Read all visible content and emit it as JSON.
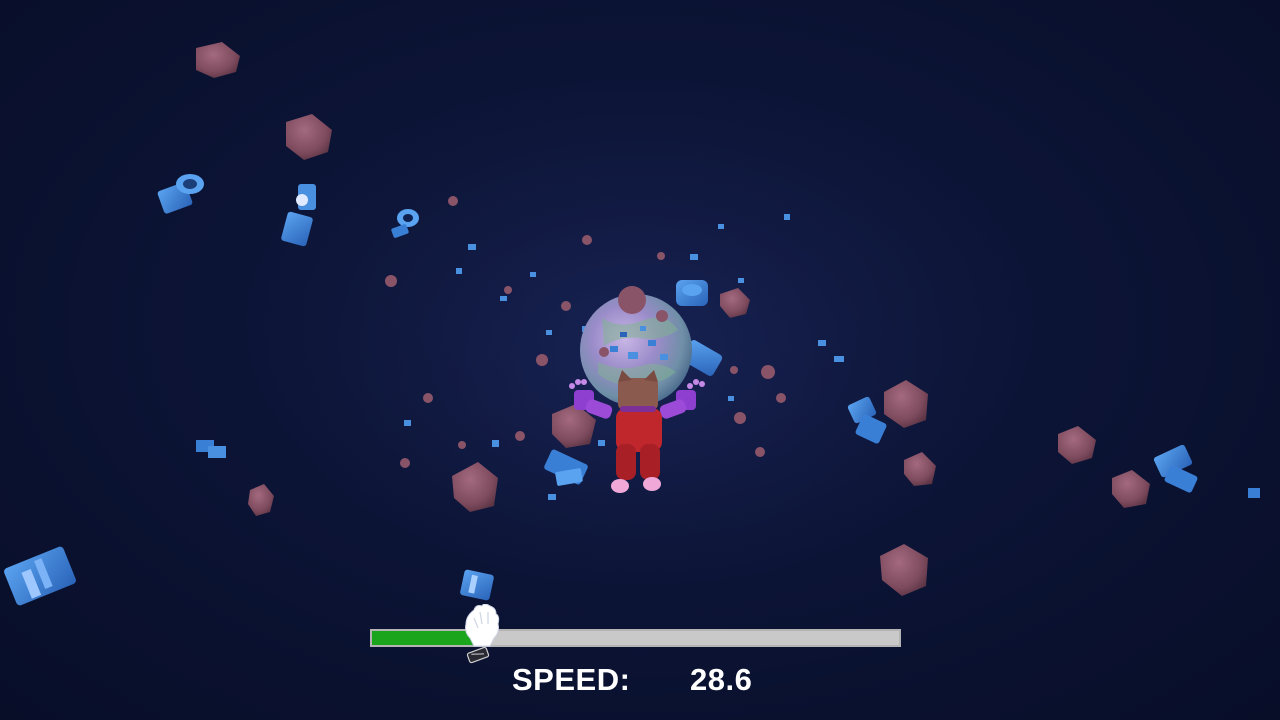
{
  "hud": {
    "speed_label": "SPEED:",
    "speed_value": "28.6",
    "progress_fraction": 0.21,
    "progress_fill_color": "#1aa51d",
    "progress_track_color": "#c9c9c9",
    "progress_marker_icon": "cat-paw-marker-icon"
  },
  "scene": {
    "player_icon": "cat-astronaut-player",
    "planet_icon": "planet",
    "debris_types": [
      "asteroid",
      "space-toilet"
    ],
    "colors": {
      "space_background": "#0a1230",
      "asteroid": "#8a5468",
      "toilet_debris": "#3a7fd6",
      "player_suit": "#c0272d",
      "player_gloves": "#8e3fd0"
    }
  }
}
